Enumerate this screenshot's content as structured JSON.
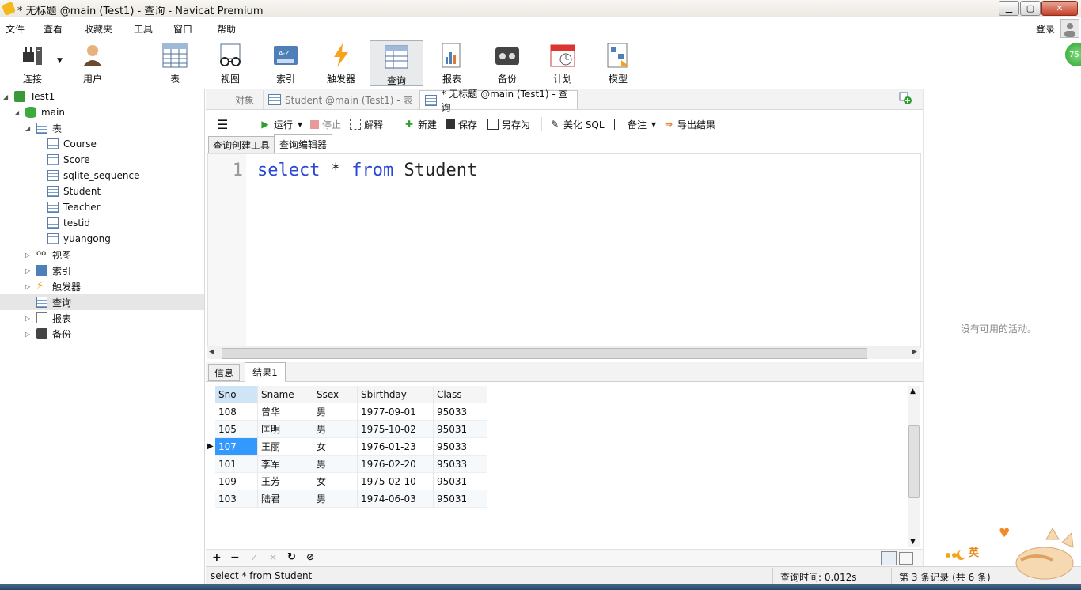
{
  "window": {
    "title": "* 无标题 @main (Test1) - 查询 - Navicat Premium"
  },
  "menu": {
    "items": [
      "文件",
      "查看",
      "收藏夹",
      "工具",
      "窗口",
      "帮助"
    ],
    "login": "登录",
    "badge": "75"
  },
  "toolbar": {
    "items": [
      "连接",
      "用户",
      "表",
      "视图",
      "索引",
      "触发器",
      "查询",
      "报表",
      "备份",
      "计划",
      "模型"
    ]
  },
  "tree": {
    "connection": "Test1",
    "database": "main",
    "tables_label": "表",
    "tables": [
      "Course",
      "Score",
      "sqlite_sequence",
      "Student",
      "Teacher",
      "testid",
      "yuangong"
    ],
    "views": "视图",
    "indexes": "索引",
    "triggers": "触发器",
    "queries": "查询",
    "reports": "报表",
    "backups": "备份"
  },
  "tabs": {
    "objects": "对象",
    "student": "Student @main (Test1) - 表",
    "query": "* 无标题 @main (Test1) - 查询"
  },
  "querytoolbar": {
    "run": "运行",
    "stop": "停止",
    "explain": "解释",
    "new": "新建",
    "save": "保存",
    "saveas": "另存为",
    "beautify": "美化 SQL",
    "comment": "备注",
    "export": "导出结果"
  },
  "subtabs": {
    "builder": "查询创建工具",
    "editor": "查询编辑器"
  },
  "editor": {
    "line": "1",
    "kw1": "select",
    "star": " * ",
    "kw2": "from",
    "table": " Student"
  },
  "results": {
    "info_tab": "信息",
    "result_tab": "结果1",
    "columns": [
      "Sno",
      "Sname",
      "Ssex",
      "Sbirthday",
      "Class"
    ],
    "rows": [
      [
        "108",
        "曾华",
        "男",
        "1977-09-01",
        "95033"
      ],
      [
        "105",
        "匡明",
        "男",
        "1975-10-02",
        "95031"
      ],
      [
        "107",
        "王丽",
        "女",
        "1976-01-23",
        "95033"
      ],
      [
        "101",
        "李军",
        "男",
        "1976-02-20",
        "95033"
      ],
      [
        "109",
        "王芳",
        "女",
        "1975-02-10",
        "95031"
      ],
      [
        "103",
        "陆君",
        "男",
        "1974-06-03",
        "95031"
      ]
    ]
  },
  "side": {
    "no_activity": "没有可用的活动。"
  },
  "status": {
    "sql": "select * from Student",
    "time": "查询时间: 0.012s",
    "records": "第 3 条记录 (共 6 条)"
  },
  "deco": {
    "ime": "英"
  },
  "colors": {
    "selected_cell": "#3399ff",
    "keyword": "#2a48d6",
    "run_green": "#2ca02c"
  }
}
